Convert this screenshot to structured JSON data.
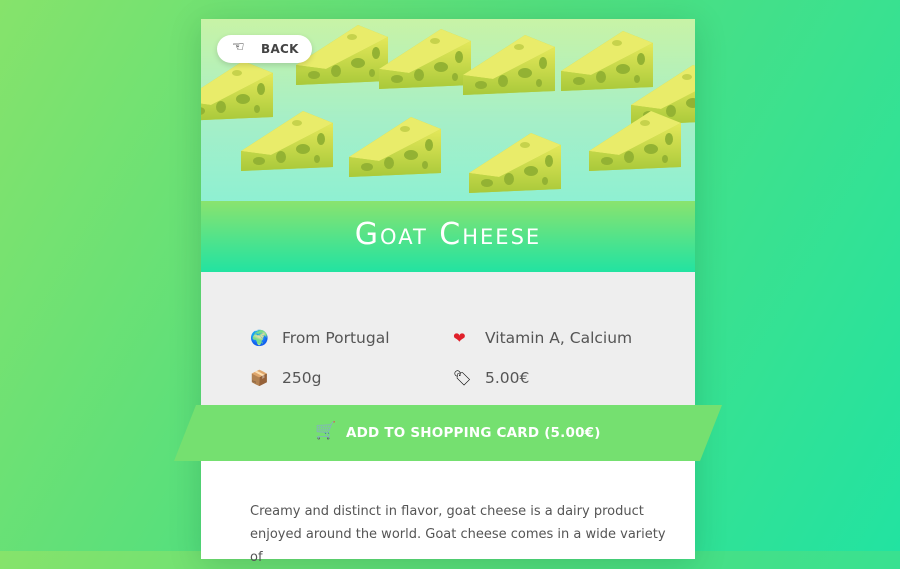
{
  "back_button": {
    "icon": "pointing-hand-left-icon",
    "label": "BACK"
  },
  "product": {
    "name": "Goat Cheese",
    "details": {
      "origin": {
        "icon": "globe-icon",
        "text": "From Portugal"
      },
      "nutrients": {
        "icon": "heart-icon",
        "text": "Vitamin A, Calcium"
      },
      "weight": {
        "icon": "package-icon",
        "text": "250g"
      },
      "price": {
        "icon": "price-tag-icon",
        "text": "5.00€"
      }
    },
    "description": "Creamy and distinct in flavor, goat cheese is a dairy product enjoyed around the world. Goat cheese comes in a wide variety of"
  },
  "cta": {
    "icon": "shopping-cart-icon",
    "label": "ADD TO SHOPPING CARD (5.00€)"
  },
  "colors": {
    "title_band_top": "#8ae36e",
    "title_band_bottom": "#22e3a1",
    "cta_background": "#75e070",
    "info_background": "#eeeeee"
  }
}
